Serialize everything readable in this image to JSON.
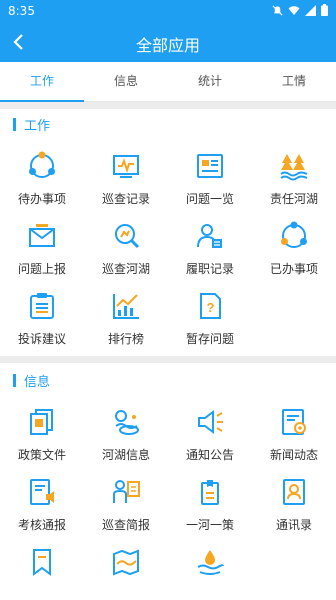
{
  "status": {
    "time": "8:35"
  },
  "header": {
    "title": "全部应用"
  },
  "tabs": [
    {
      "label": "工作"
    },
    {
      "label": "信息"
    },
    {
      "label": "统计"
    },
    {
      "label": "工情"
    }
  ],
  "work": {
    "title": "工作",
    "items": [
      {
        "label": "待办事项",
        "icon": "pending-items-icon"
      },
      {
        "label": "巡查记录",
        "icon": "patrol-record-icon"
      },
      {
        "label": "问题一览",
        "icon": "issue-list-icon"
      },
      {
        "label": "责任河湖",
        "icon": "responsible-river-icon"
      },
      {
        "label": "问题上报",
        "icon": "report-issue-icon"
      },
      {
        "label": "巡查河湖",
        "icon": "patrol-river-icon"
      },
      {
        "label": "履职记录",
        "icon": "duty-record-icon"
      },
      {
        "label": "已办事项",
        "icon": "done-items-icon"
      },
      {
        "label": "投诉建议",
        "icon": "complaint-icon"
      },
      {
        "label": "排行榜",
        "icon": "ranking-icon"
      },
      {
        "label": "暂存问题",
        "icon": "draft-issue-icon"
      }
    ]
  },
  "info": {
    "title": "信息",
    "items": [
      {
        "label": "政策文件",
        "icon": "policy-file-icon"
      },
      {
        "label": "河湖信息",
        "icon": "river-info-icon"
      },
      {
        "label": "通知公告",
        "icon": "notice-icon"
      },
      {
        "label": "新闻动态",
        "icon": "news-icon"
      },
      {
        "label": "考核通报",
        "icon": "assessment-icon"
      },
      {
        "label": "巡查简报",
        "icon": "patrol-brief-icon"
      },
      {
        "label": "一河一策",
        "icon": "river-policy-icon"
      },
      {
        "label": "通讯录",
        "icon": "contacts-icon"
      },
      {
        "label": "",
        "icon": "bookmark-icon"
      },
      {
        "label": "",
        "icon": "river-map-icon"
      },
      {
        "label": "",
        "icon": "water-icon"
      }
    ]
  },
  "colors": {
    "primary": "#1e9ff2",
    "accent": "#f5a623"
  }
}
